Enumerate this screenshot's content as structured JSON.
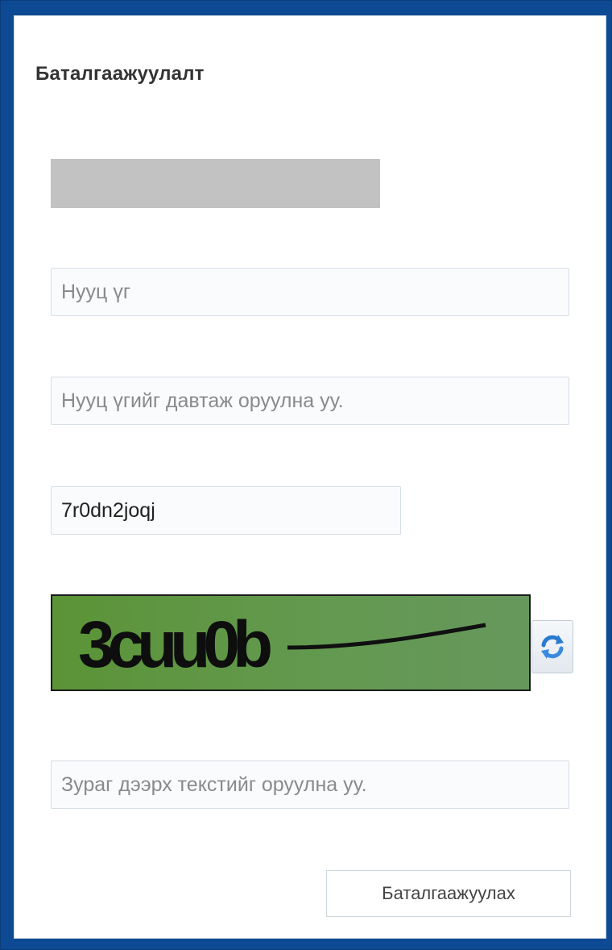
{
  "form": {
    "title": "Баталгаажуулалт",
    "password": {
      "value": "",
      "placeholder": "Нууц үг"
    },
    "password_confirm": {
      "value": "",
      "placeholder": "Нууц үгийг давтаж оруулна уу."
    },
    "code": {
      "value": "7r0dn2joqj",
      "placeholder": ""
    },
    "captcha": {
      "image_text": "3cuu0b",
      "background_colors": [
        "#5b9337",
        "#66985d"
      ],
      "refresh_icon": "refresh-icon",
      "input": {
        "value": "",
        "placeholder": "Зураг дээрх текстийг оруулна уу."
      }
    },
    "submit_label": "Баталгаажуулах"
  },
  "colors": {
    "frame": "#0d4a93",
    "panel": "#ffffff",
    "masked": "#c2c2c2"
  }
}
